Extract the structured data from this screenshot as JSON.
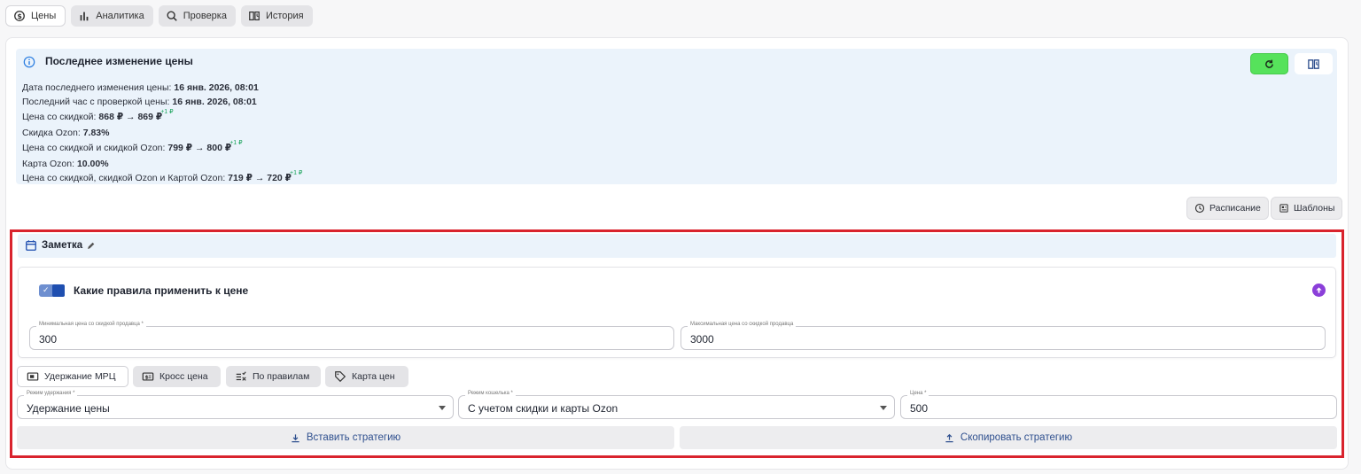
{
  "nav": {
    "tabs": [
      {
        "label": "Цены",
        "icon": "price-tag-cycle-icon",
        "active": true
      },
      {
        "label": "Аналитика",
        "icon": "bar-chart-icon",
        "active": false
      },
      {
        "label": "Проверка",
        "icon": "search-icon",
        "active": false
      },
      {
        "label": "История",
        "icon": "history-book-icon",
        "active": false
      }
    ]
  },
  "last_change": {
    "title": "Последнее изменение цены",
    "date_label": "Дата последнего изменения цены:",
    "date_value": "16 янв. 2026, 08:01",
    "check_label": "Последний час с проверкой цены:",
    "check_value": "16 янв. 2026, 08:01",
    "discount_price_label": "Цена со скидкой:",
    "discount_price_value": "868 ₽ → 869 ₽",
    "discount_price_delta": "+1 ₽",
    "ozon_discount_label": "Скидка Ozon:",
    "ozon_discount_value": "7.83%",
    "price_ozon_label": "Цена со скидкой и скидкой Ozon:",
    "price_ozon_value": "799 ₽ → 800 ₽",
    "price_ozon_delta": "+1 ₽",
    "ozon_card_label": "Карта Ozon:",
    "ozon_card_value": "10.00%",
    "price_card_label": "Цена со скидкой, скидкой Ozon и Картой Ozon:",
    "price_card_value": "719 ₽ → 720 ₽",
    "price_card_delta": "+1 ₽"
  },
  "actions": {
    "schedule_label": "Расписание",
    "templates_label": "Шаблоны"
  },
  "note": {
    "label": "Заметка"
  },
  "rules": {
    "title": "Какие правила применить к цене",
    "enabled": true,
    "min_label": "Минимальная цена со скидкой продавца *",
    "min_value": "300",
    "max_label": "Максимальная цена со скидкой продавца",
    "max_value": "3000"
  },
  "strategy": {
    "tabs": [
      {
        "label": "Удержание МРЦ",
        "icon": "mrc-icon",
        "active": true
      },
      {
        "label": "Кросс цена",
        "icon": "cross-price-icon",
        "active": false
      },
      {
        "label": "По правилам",
        "icon": "rules-icon",
        "active": false
      },
      {
        "label": "Карта цен",
        "icon": "tag-icon",
        "active": false
      }
    ],
    "mode_label": "Режим удержания *",
    "mode_value": "Удержание цены",
    "wallet_label": "Режим кошелька *",
    "wallet_value": "С учетом скидки и карты Ozon",
    "price_label": "Цена *",
    "price_value": "500",
    "paste_label": "Вставить стратегию",
    "copy_label": "Скопировать стратегию"
  },
  "colors": {
    "accent_green": "#56e25b",
    "info_bg": "#ebf3fb",
    "highlight_red": "#d9232d",
    "link_blue": "#2e4f8e",
    "toggle_blue": "#1f4fb0",
    "up_purple": "#8b3fd9"
  }
}
